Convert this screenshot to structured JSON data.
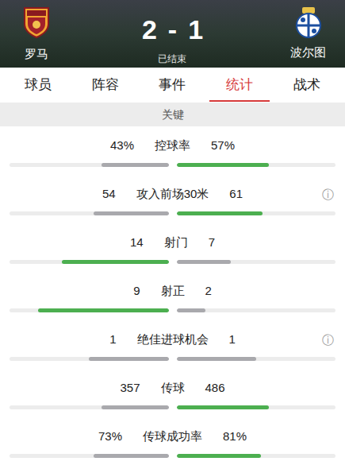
{
  "match": {
    "home": {
      "name": "罗马",
      "score": "2"
    },
    "away": {
      "name": "波尔图",
      "score": "1"
    },
    "separator": "-",
    "status": "已结束"
  },
  "tabs": [
    {
      "label": "球员",
      "selected": false
    },
    {
      "label": "阵容",
      "selected": false
    },
    {
      "label": "事件",
      "selected": false
    },
    {
      "label": "统计",
      "selected": true
    },
    {
      "label": "战术",
      "selected": false
    }
  ],
  "section": "关键",
  "stats": [
    {
      "label": "控球率",
      "home": "43%",
      "away": "57%",
      "home_level": 0.42,
      "away_level": 0.58,
      "home_leading": false,
      "away_leading": true
    },
    {
      "label": "攻入前场30米",
      "home": "54",
      "away": "61",
      "home_level": 0.47,
      "away_level": 0.54,
      "home_leading": false,
      "away_leading": true,
      "info": "ⓘ"
    },
    {
      "label": "射门",
      "home": "14",
      "away": "7",
      "home_level": 0.67,
      "away_level": 0.34,
      "home_leading": true,
      "away_leading": false
    },
    {
      "label": "射正",
      "home": "9",
      "away": "2",
      "home_level": 0.82,
      "away_level": 0.18,
      "home_leading": true,
      "away_leading": false
    },
    {
      "label": "绝佳进球机会",
      "home": "1",
      "away": "1",
      "home_level": 0.5,
      "away_level": 0.5,
      "home_leading": false,
      "away_leading": false,
      "info": "ⓘ"
    },
    {
      "label": "传球",
      "home": "357",
      "away": "486",
      "home_level": 0.42,
      "away_level": 0.58,
      "home_leading": false,
      "away_leading": true
    },
    {
      "label": "传球成功率",
      "home": "73%",
      "away": "81%",
      "home_level": 0.47,
      "away_level": 0.53,
      "home_leading": false,
      "away_leading": true
    }
  ]
}
